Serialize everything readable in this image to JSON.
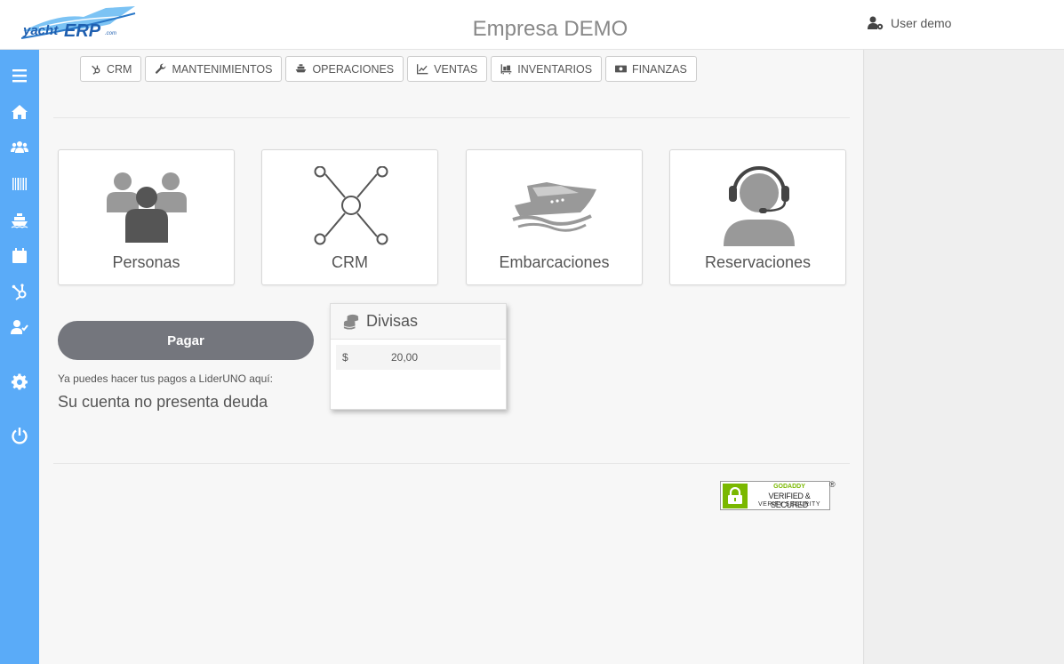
{
  "header": {
    "logo_text": "yachtERP.com",
    "company": "Empresa DEMO",
    "user": "User demo"
  },
  "sidebar": {
    "items": [
      {
        "icon": "menu-icon"
      },
      {
        "icon": "home-icon"
      },
      {
        "icon": "users-icon"
      },
      {
        "icon": "barcode-icon"
      },
      {
        "icon": "ship-icon"
      },
      {
        "icon": "calendar-icon"
      },
      {
        "icon": "hubspot-icon"
      },
      {
        "icon": "user-check-icon"
      },
      {
        "icon": "gear-icon"
      },
      {
        "icon": "power-icon"
      }
    ]
  },
  "topnav": [
    {
      "label": "CRM",
      "icon": "hubspot-icon"
    },
    {
      "label": "MANTENIMIENTOS",
      "icon": "wrench-icon"
    },
    {
      "label": "OPERACIONES",
      "icon": "ship-icon"
    },
    {
      "label": "VENTAS",
      "icon": "chart-line-icon"
    },
    {
      "label": "INVENTARIOS",
      "icon": "pallet-icon"
    },
    {
      "label": "FINANZAS",
      "icon": "money-icon"
    }
  ],
  "tiles": [
    {
      "label": "Personas",
      "icon": "people-group-icon"
    },
    {
      "label": "CRM",
      "icon": "network-icon"
    },
    {
      "label": "Embarcaciones",
      "icon": "yacht-icon"
    },
    {
      "label": "Reservaciones",
      "icon": "headset-agent-icon"
    }
  ],
  "payment": {
    "button": "Pagar",
    "hint": "Ya puedes hacer tus pagos a LiderUNO aquí:",
    "status": "Su cuenta no presenta deuda"
  },
  "divisas": {
    "title": "Divisas",
    "rows": [
      {
        "currency": "$",
        "amount": "20,00"
      }
    ]
  },
  "badge": {
    "line1": "GODADDY",
    "line2": "VERIFIED & SECURED",
    "line3": "VERIFY SECURITY",
    "reg": "®"
  },
  "colors": {
    "sidebar": "#5aabf8",
    "pay_button": "#74767d",
    "badge_green": "#7ab800"
  }
}
